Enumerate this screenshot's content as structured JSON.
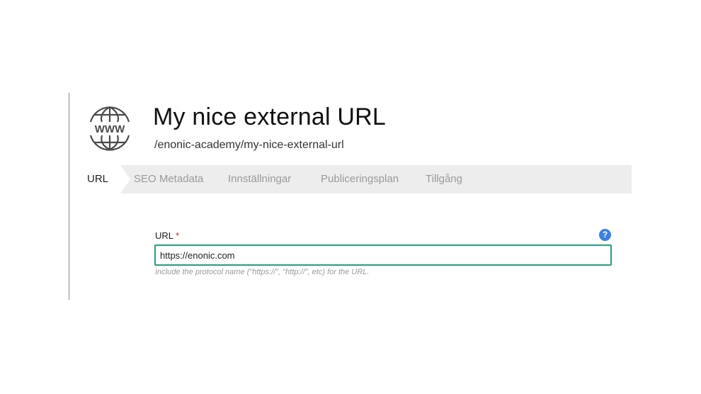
{
  "header": {
    "title": "My nice external URL",
    "path": "/enonic-academy/my-nice-external-url",
    "icon": "globe-www-icon",
    "icon_text": "WWW"
  },
  "tabs": [
    {
      "label": "URL",
      "active": true
    },
    {
      "label": "SEO Metadata",
      "active": false
    },
    {
      "label": "Innställningar",
      "active": false
    },
    {
      "label": "Publiceringsplan",
      "active": false
    },
    {
      "label": "Tillgång",
      "active": false
    }
  ],
  "form": {
    "url_label": "URL",
    "required_marker": "*",
    "help_icon": "?",
    "url_value": "https://enonic.com",
    "hint": "Include the protocol name (\"https://\", \"http://\", etc) for the URL."
  },
  "colors": {
    "input_border": "#1fa784",
    "help_icon": "#3b82e0",
    "required": "#c62828",
    "tab_bar": "#ededed"
  }
}
